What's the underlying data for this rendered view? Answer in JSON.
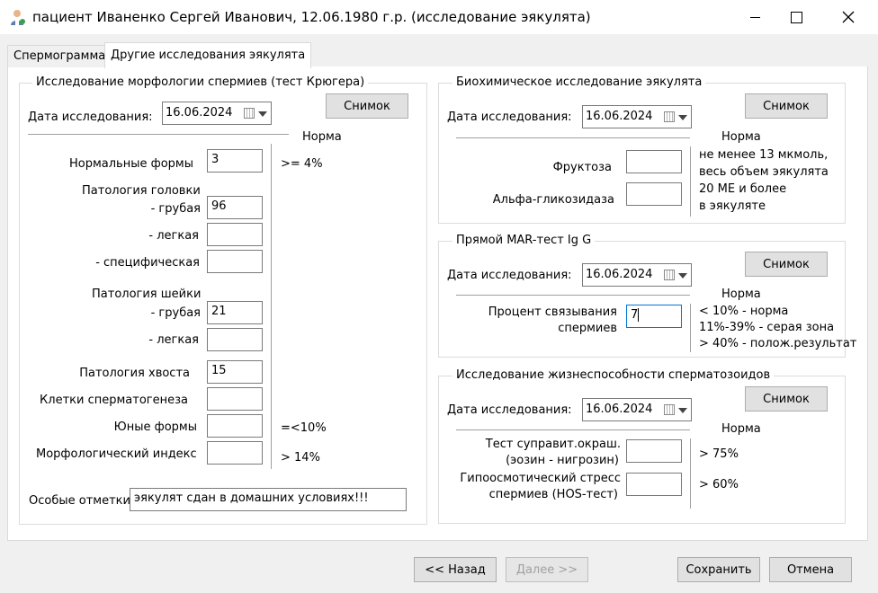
{
  "window": {
    "title": "пациент Иваненко Сергей Иванович, 12.06.1980 г.р. (исследование эякулята)"
  },
  "tabs": [
    {
      "label": "Спермограмма"
    },
    {
      "label": "Другие исследования эякулята"
    }
  ],
  "kruger": {
    "title": "Исследование морфологии спермиев (тест Крюгера)",
    "date_label": "Дата исследования:",
    "date": "16.06.2024",
    "snapshot": "Снимок",
    "norm_header": "Норма",
    "normal_forms": {
      "label": "Нормальные формы",
      "value": "3",
      "norm": ">= 4%"
    },
    "head_pathology": "Патология головки",
    "head_rough": {
      "label": "- грубая",
      "value": "96"
    },
    "head_light": {
      "label": "- легкая",
      "value": ""
    },
    "head_specific": {
      "label": "- специфическая",
      "value": ""
    },
    "neck_pathology": "Патология шейки",
    "neck_rough": {
      "label": "- грубая",
      "value": "21"
    },
    "neck_light": {
      "label": "- легкая",
      "value": ""
    },
    "tail": {
      "label": "Патология хвоста",
      "value": "15"
    },
    "spermatogenesis": {
      "label": "Клетки сперматогенеза",
      "value": ""
    },
    "young": {
      "label": "Юные формы",
      "value": "",
      "norm": "=<10%"
    },
    "morph_index": {
      "label": "Морфологический индекс",
      "value": "",
      "norm": "> 14%"
    },
    "notes_label": "Особые отметки",
    "notes_value": "эякулят сдан в домашних условиях!!!"
  },
  "biochem": {
    "title": "Биохимическое исследование эякулята",
    "date_label": "Дата исследования:",
    "date": "16.06.2024",
    "snapshot": "Снимок",
    "norm_header": "Норма",
    "fructose": {
      "label": "Фруктоза",
      "value": ""
    },
    "glucosidase": {
      "label": "Альфа-гликозидаза",
      "value": ""
    },
    "norm_lines": [
      "не менее 13 мкмоль,",
      "весь объем эякулята",
      "20 МЕ и более",
      "в эякуляте"
    ]
  },
  "mar": {
    "title": "Прямой MAR-тест Ig G",
    "date_label": "Дата исследования:",
    "date": "16.06.2024",
    "snapshot": "Снимок",
    "norm_header": "Норма",
    "binding_label_1": "Процент связывания",
    "binding_label_2": "спермиев",
    "binding_value": "7",
    "norm_lines": [
      "< 10% - норма",
      "11%-39% - серая зона",
      "> 40% - полож.результат"
    ]
  },
  "viability": {
    "title": "Исследование жизнеспособности сперматозоидов",
    "date_label": "Дата исследования:",
    "date": "16.06.2024",
    "snapshot": "Снимок",
    "norm_header": "Норма",
    "stain_label_1": "Тест суправит.окраш.",
    "stain_label_2": "(эозин - нигрозин)",
    "stain_value": "",
    "stain_norm": "> 75%",
    "hos_label_1": "Гипоосмотический стресс",
    "hos_label_2": "спермиев (HOS-тест)",
    "hos_value": "",
    "hos_norm": "> 60%"
  },
  "footer": {
    "back": "<< Назад",
    "next": "Далее >>",
    "save": "Сохранить",
    "cancel": "Отмена"
  }
}
